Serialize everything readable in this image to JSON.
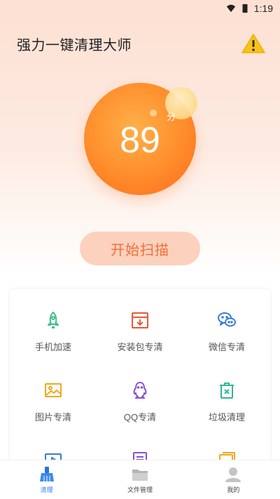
{
  "status": {
    "time": "1:19"
  },
  "header": {
    "title": "强力一键清理大师"
  },
  "score": {
    "value": "89",
    "unit": "分"
  },
  "scan": {
    "label": "开始扫描"
  },
  "features": [
    {
      "label": "手机加速",
      "icon": "rocket-icon",
      "color": "#3fbf8a"
    },
    {
      "label": "安装包专清",
      "icon": "package-icon",
      "color": "#e45a3c"
    },
    {
      "label": "微信专清",
      "icon": "wechat-icon",
      "color": "#3a7bd6"
    },
    {
      "label": "图片专清",
      "icon": "image-icon",
      "color": "#f0a820"
    },
    {
      "label": "QQ专清",
      "icon": "qq-icon",
      "color": "#8a4fd6"
    },
    {
      "label": "垃圾清理",
      "icon": "trash-icon",
      "color": "#2fb59a"
    }
  ],
  "nav": [
    {
      "label": "清理",
      "icon": "broom-icon"
    },
    {
      "label": "文件管理",
      "icon": "folder-icon"
    },
    {
      "label": "我的",
      "icon": "user-icon"
    }
  ],
  "colors": {
    "accent": "#ff8c2a",
    "scan_bg": "#fcd1bd",
    "scan_text": "#f0703a",
    "nav_active": "#3a7bf0"
  }
}
